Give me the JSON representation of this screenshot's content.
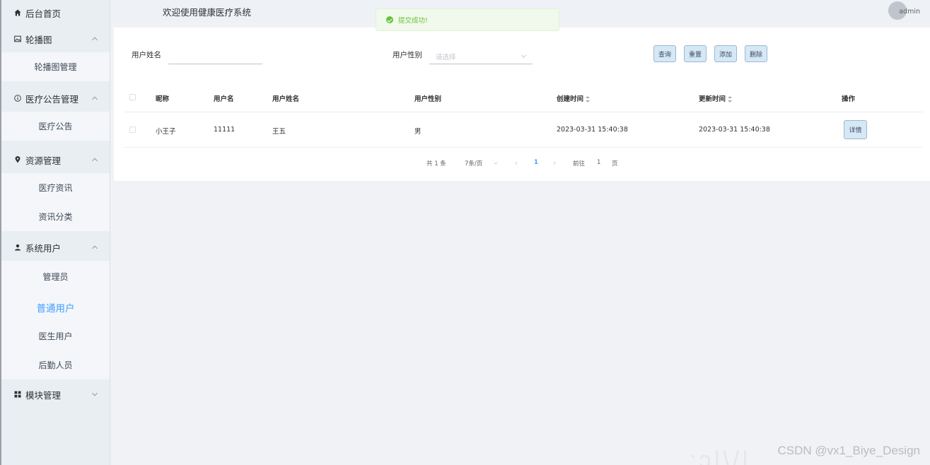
{
  "sidebar": {
    "home": {
      "label": "后台首页",
      "icon": "home-icon"
    },
    "groups": [
      {
        "label": "轮播图",
        "icon": "picture-icon",
        "expanded": true,
        "items": [
          "轮播图管理"
        ]
      },
      {
        "label": "医疗公告管理",
        "icon": "info-circle-icon",
        "expanded": true,
        "items": [
          "医疗公告"
        ]
      },
      {
        "label": "资源管理",
        "icon": "location-icon",
        "expanded": true,
        "items": [
          "医疗资讯",
          "资讯分类"
        ]
      },
      {
        "label": "系统用户",
        "icon": "user-icon",
        "expanded": true,
        "items": [
          "管理员",
          "普通用户",
          "医生用户",
          "后勤人员"
        ]
      },
      {
        "label": "模块管理",
        "icon": "grid-icon",
        "expanded": false,
        "items": []
      }
    ],
    "active_item": "普通用户"
  },
  "header": {
    "title": "欢迎使用健康医疗系统",
    "user": "admin"
  },
  "toast": {
    "message": "提交成功!",
    "type": "success"
  },
  "filters": {
    "name_label": "用户姓名",
    "name_value": "",
    "gender_label": "用户性别",
    "gender_placeholder": "请选择"
  },
  "buttons": {
    "query": "查询",
    "reset": "重置",
    "add": "添加",
    "delete": "删除"
  },
  "table": {
    "columns": [
      "昵称",
      "用户名",
      "用户姓名",
      "用户性别",
      "创建时间",
      "更新时间",
      "操作"
    ],
    "rows": [
      {
        "nickname": "小王子",
        "username": "11111",
        "real_name": "王五",
        "gender": "男",
        "created": "2023-03-31 15:40:38",
        "updated": "2023-03-31 15:40:38",
        "action": "详情"
      }
    ]
  },
  "pagination": {
    "total": "共 1 条",
    "page_size": "7条/页",
    "current_page": "1",
    "goto_label": "前往",
    "goto_value": "1",
    "goto_suffix": "页"
  },
  "watermark": "CSDN @vx1_Biye_Design",
  "colors": {
    "accent": "#409eff",
    "success": "#67c23a",
    "sidebar_bg": "#e9eef3"
  }
}
